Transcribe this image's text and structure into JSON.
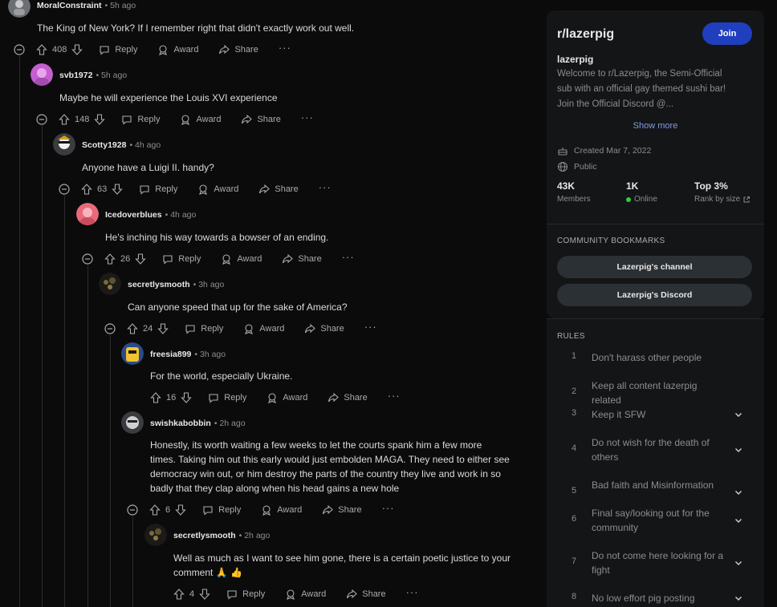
{
  "comments": [
    {
      "author": "MoralConstraint",
      "time": "5h ago",
      "text": "The King of New York? If I remember right that didn't exactly work out well.",
      "score": "408"
    },
    {
      "author": "svb1972",
      "time": "5h ago",
      "text": "Maybe he will experience the Louis XVI experience",
      "score": "148"
    },
    {
      "author": "Scotty1928",
      "time": "4h ago",
      "text": "Anyone have a Luigi II. handy?",
      "score": "63"
    },
    {
      "author": "Icedoverblues",
      "time": "4h ago",
      "text": "He's inching his way towards a bowser of an ending.",
      "score": "26"
    },
    {
      "author": "secretlysmooth",
      "time": "3h ago",
      "text": "Can anyone speed that up for the sake of America?",
      "score": "24"
    },
    {
      "author": "freesia899",
      "time": "3h ago",
      "text": "For the world, especially Ukraine.",
      "score": "16"
    },
    {
      "author": "swishkabobbin",
      "time": "2h ago",
      "text": [
        "Honestly, its worth waiting a few weeks to let the courts spank him a few more",
        "times. Taking him out this early would just embolden MAGA. They need to either see",
        "democracy win out, or him destroy the parts of the country they live and work in so",
        "badly that they clap along when his head gains a new hole"
      ],
      "score": "6"
    },
    {
      "author": "secretlysmooth",
      "time": "2h ago",
      "text": [
        "Well as much as I want to see him gone, there is a certain poetic justice to your",
        "comment 🙏 👍"
      ],
      "score": "4"
    }
  ],
  "actions": {
    "reply": "Reply",
    "award": "Award",
    "share": "Share",
    "more": "···"
  },
  "sidebar": {
    "title": "r/lazerpig",
    "join": "Join",
    "name": "lazerpig",
    "description": [
      "Welcome to r/Lazerpig, the Semi-Official",
      "sub with an official gay themed sushi bar!",
      "Join the Official Discord @..."
    ],
    "show_more": "Show more",
    "created": "Created Mar 7, 2022",
    "visibility": "Public",
    "stats": [
      {
        "value": "43K",
        "label": "Members"
      },
      {
        "value": "1K",
        "label": "Online"
      },
      {
        "value": "Top 3%",
        "label": "Rank by size"
      }
    ],
    "bookmarks_heading": "COMMUNITY BOOKMARKS",
    "bookmarks": [
      "Lazerpig's channel",
      "Lazerpig's Discord"
    ],
    "rules_heading": "RULES",
    "rules": [
      {
        "n": "1",
        "text": "Don't harass other people",
        "expand": false
      },
      {
        "n": "2",
        "text": "Keep all content lazerpig related",
        "expand": false
      },
      {
        "n": "3",
        "text": "Keep it SFW",
        "expand": true
      },
      {
        "n": "4",
        "text": "Do not wish for the death of others",
        "expand": true
      },
      {
        "n": "5",
        "text": "Bad faith and Misinformation",
        "expand": true
      },
      {
        "n": "6",
        "text": "Final say/looking out for the community",
        "expand": true
      },
      {
        "n": "7",
        "text": "Do not come here looking for a fight",
        "expand": true
      },
      {
        "n": "8",
        "text": "No low effort pig posting",
        "expand": true
      }
    ]
  },
  "colors": {
    "accent": "#1f3fbf",
    "online": "#2ecc40",
    "link": "#7d9be6"
  }
}
